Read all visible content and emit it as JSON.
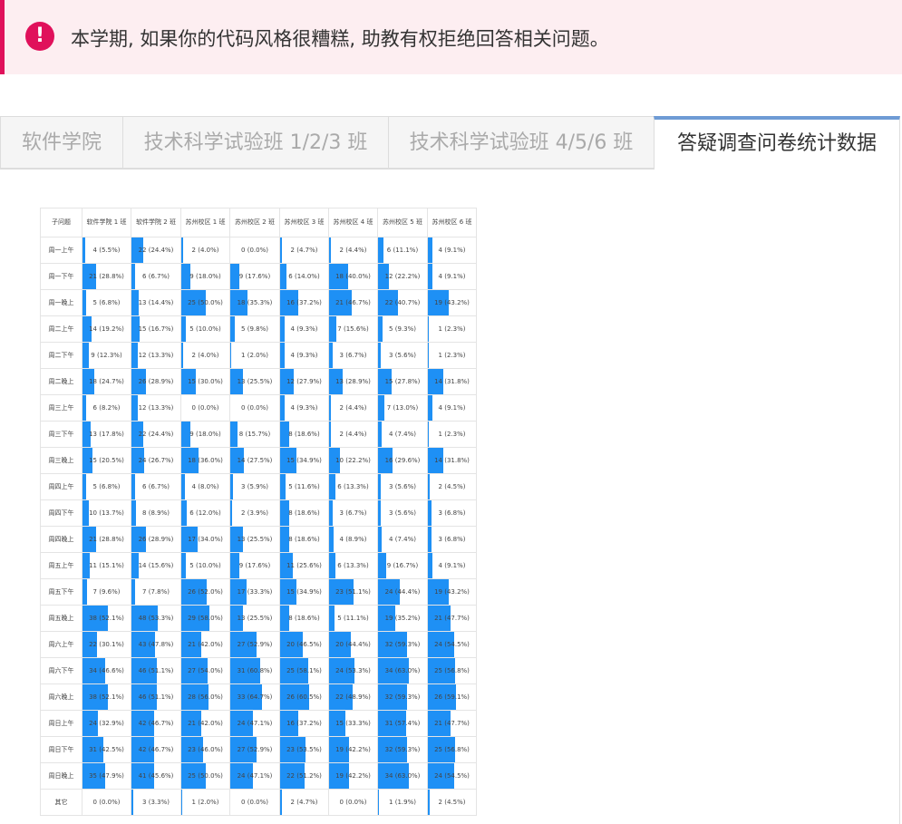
{
  "alert": {
    "icon": "exclamation-icon",
    "icon_glyph": "!",
    "text": "本学期, 如果你的代码风格很糟糕, 助教有权拒绝回答相关问题。"
  },
  "tabs": [
    {
      "label": "软件学院",
      "active": false
    },
    {
      "label": "技术科学试验班 1/2/3 班",
      "active": false
    },
    {
      "label": "技术科学试验班 4/5/6 班",
      "active": false
    },
    {
      "label": "答疑调查问卷统计数据",
      "active": true
    }
  ],
  "colors": {
    "accent": "#e0115b",
    "bar": "#1e90f5",
    "active_tab": "#6e9bd5"
  },
  "table": {
    "corner": "子问题",
    "columns": [
      "软件学院 1 班",
      "软件学院 2 班",
      "苏州校区 1 班",
      "苏州校区 2 班",
      "苏州校区 3 班",
      "苏州校区 4 班",
      "苏州校区 5 班",
      "苏州校区 6 班"
    ],
    "rows": [
      {
        "label": "周一上午",
        "cells": [
          [
            4,
            "5.5%"
          ],
          [
            22,
            "24.4%"
          ],
          [
            2,
            "4.0%"
          ],
          [
            0,
            "0.0%"
          ],
          [
            2,
            "4.7%"
          ],
          [
            2,
            "4.4%"
          ],
          [
            6,
            "11.1%"
          ],
          [
            4,
            "9.1%"
          ]
        ]
      },
      {
        "label": "周一下午",
        "cells": [
          [
            21,
            "28.8%"
          ],
          [
            6,
            "6.7%"
          ],
          [
            9,
            "18.0%"
          ],
          [
            9,
            "17.6%"
          ],
          [
            6,
            "14.0%"
          ],
          [
            18,
            "40.0%"
          ],
          [
            12,
            "22.2%"
          ],
          [
            4,
            "9.1%"
          ]
        ]
      },
      {
        "label": "周一晚上",
        "cells": [
          [
            5,
            "6.8%"
          ],
          [
            13,
            "14.4%"
          ],
          [
            25,
            "50.0%"
          ],
          [
            18,
            "35.3%"
          ],
          [
            16,
            "37.2%"
          ],
          [
            21,
            "46.7%"
          ],
          [
            22,
            "40.7%"
          ],
          [
            19,
            "43.2%"
          ]
        ]
      },
      {
        "label": "周二上午",
        "cells": [
          [
            14,
            "19.2%"
          ],
          [
            15,
            "16.7%"
          ],
          [
            5,
            "10.0%"
          ],
          [
            5,
            "9.8%"
          ],
          [
            4,
            "9.3%"
          ],
          [
            7,
            "15.6%"
          ],
          [
            5,
            "9.3%"
          ],
          [
            1,
            "2.3%"
          ]
        ]
      },
      {
        "label": "周二下午",
        "cells": [
          [
            9,
            "12.3%"
          ],
          [
            12,
            "13.3%"
          ],
          [
            2,
            "4.0%"
          ],
          [
            1,
            "2.0%"
          ],
          [
            4,
            "9.3%"
          ],
          [
            3,
            "6.7%"
          ],
          [
            3,
            "5.6%"
          ],
          [
            1,
            "2.3%"
          ]
        ]
      },
      {
        "label": "周二晚上",
        "cells": [
          [
            18,
            "24.7%"
          ],
          [
            26,
            "28.9%"
          ],
          [
            15,
            "30.0%"
          ],
          [
            13,
            "25.5%"
          ],
          [
            12,
            "27.9%"
          ],
          [
            13,
            "28.9%"
          ],
          [
            15,
            "27.8%"
          ],
          [
            14,
            "31.8%"
          ]
        ]
      },
      {
        "label": "周三上午",
        "cells": [
          [
            6,
            "8.2%"
          ],
          [
            12,
            "13.3%"
          ],
          [
            0,
            "0.0%"
          ],
          [
            0,
            "0.0%"
          ],
          [
            4,
            "9.3%"
          ],
          [
            2,
            "4.4%"
          ],
          [
            7,
            "13.0%"
          ],
          [
            4,
            "9.1%"
          ]
        ]
      },
      {
        "label": "周三下午",
        "cells": [
          [
            13,
            "17.8%"
          ],
          [
            22,
            "24.4%"
          ],
          [
            9,
            "18.0%"
          ],
          [
            8,
            "15.7%"
          ],
          [
            8,
            "18.6%"
          ],
          [
            2,
            "4.4%"
          ],
          [
            4,
            "7.4%"
          ],
          [
            1,
            "2.3%"
          ]
        ]
      },
      {
        "label": "周三晚上",
        "cells": [
          [
            15,
            "20.5%"
          ],
          [
            24,
            "26.7%"
          ],
          [
            18,
            "36.0%"
          ],
          [
            14,
            "27.5%"
          ],
          [
            15,
            "34.9%"
          ],
          [
            10,
            "22.2%"
          ],
          [
            16,
            "29.6%"
          ],
          [
            14,
            "31.8%"
          ]
        ]
      },
      {
        "label": "周四上午",
        "cells": [
          [
            5,
            "6.8%"
          ],
          [
            6,
            "6.7%"
          ],
          [
            4,
            "8.0%"
          ],
          [
            3,
            "5.9%"
          ],
          [
            5,
            "11.6%"
          ],
          [
            6,
            "13.3%"
          ],
          [
            3,
            "5.6%"
          ],
          [
            2,
            "4.5%"
          ]
        ]
      },
      {
        "label": "周四下午",
        "cells": [
          [
            10,
            "13.7%"
          ],
          [
            8,
            "8.9%"
          ],
          [
            6,
            "12.0%"
          ],
          [
            2,
            "3.9%"
          ],
          [
            8,
            "18.6%"
          ],
          [
            3,
            "6.7%"
          ],
          [
            3,
            "5.6%"
          ],
          [
            3,
            "6.8%"
          ]
        ]
      },
      {
        "label": "周四晚上",
        "cells": [
          [
            21,
            "28.8%"
          ],
          [
            26,
            "28.9%"
          ],
          [
            17,
            "34.0%"
          ],
          [
            13,
            "25.5%"
          ],
          [
            8,
            "18.6%"
          ],
          [
            4,
            "8.9%"
          ],
          [
            4,
            "7.4%"
          ],
          [
            3,
            "6.8%"
          ]
        ]
      },
      {
        "label": "周五上午",
        "cells": [
          [
            11,
            "15.1%"
          ],
          [
            14,
            "15.6%"
          ],
          [
            5,
            "10.0%"
          ],
          [
            9,
            "17.6%"
          ],
          [
            11,
            "25.6%"
          ],
          [
            6,
            "13.3%"
          ],
          [
            9,
            "16.7%"
          ],
          [
            4,
            "9.1%"
          ]
        ]
      },
      {
        "label": "周五下午",
        "cells": [
          [
            7,
            "9.6%"
          ],
          [
            7,
            "7.8%"
          ],
          [
            26,
            "52.0%"
          ],
          [
            17,
            "33.3%"
          ],
          [
            15,
            "34.9%"
          ],
          [
            23,
            "51.1%"
          ],
          [
            24,
            "44.4%"
          ],
          [
            19,
            "43.2%"
          ]
        ]
      },
      {
        "label": "周五晚上",
        "cells": [
          [
            38,
            "52.1%"
          ],
          [
            48,
            "53.3%"
          ],
          [
            29,
            "58.0%"
          ],
          [
            13,
            "25.5%"
          ],
          [
            8,
            "18.6%"
          ],
          [
            5,
            "11.1%"
          ],
          [
            19,
            "35.2%"
          ],
          [
            21,
            "47.7%"
          ]
        ]
      },
      {
        "label": "周六上午",
        "cells": [
          [
            22,
            "30.1%"
          ],
          [
            43,
            "47.8%"
          ],
          [
            21,
            "42.0%"
          ],
          [
            27,
            "52.9%"
          ],
          [
            20,
            "46.5%"
          ],
          [
            20,
            "44.4%"
          ],
          [
            32,
            "59.3%"
          ],
          [
            24,
            "54.5%"
          ]
        ]
      },
      {
        "label": "周六下午",
        "cells": [
          [
            34,
            "46.6%"
          ],
          [
            46,
            "51.1%"
          ],
          [
            27,
            "54.0%"
          ],
          [
            31,
            "60.8%"
          ],
          [
            25,
            "58.1%"
          ],
          [
            24,
            "53.3%"
          ],
          [
            34,
            "63.0%"
          ],
          [
            25,
            "56.8%"
          ]
        ]
      },
      {
        "label": "周六晚上",
        "cells": [
          [
            38,
            "52.1%"
          ],
          [
            46,
            "51.1%"
          ],
          [
            28,
            "56.0%"
          ],
          [
            33,
            "64.7%"
          ],
          [
            26,
            "60.5%"
          ],
          [
            22,
            "48.9%"
          ],
          [
            32,
            "59.3%"
          ],
          [
            26,
            "59.1%"
          ]
        ]
      },
      {
        "label": "周日上午",
        "cells": [
          [
            24,
            "32.9%"
          ],
          [
            42,
            "46.7%"
          ],
          [
            21,
            "42.0%"
          ],
          [
            24,
            "47.1%"
          ],
          [
            16,
            "37.2%"
          ],
          [
            15,
            "33.3%"
          ],
          [
            31,
            "57.4%"
          ],
          [
            21,
            "47.7%"
          ]
        ]
      },
      {
        "label": "周日下午",
        "cells": [
          [
            31,
            "42.5%"
          ],
          [
            42,
            "46.7%"
          ],
          [
            23,
            "46.0%"
          ],
          [
            27,
            "52.9%"
          ],
          [
            23,
            "53.5%"
          ],
          [
            19,
            "42.2%"
          ],
          [
            32,
            "59.3%"
          ],
          [
            25,
            "56.8%"
          ]
        ]
      },
      {
        "label": "周日晚上",
        "cells": [
          [
            35,
            "47.9%"
          ],
          [
            41,
            "45.6%"
          ],
          [
            25,
            "50.0%"
          ],
          [
            24,
            "47.1%"
          ],
          [
            22,
            "51.2%"
          ],
          [
            19,
            "42.2%"
          ],
          [
            34,
            "63.0%"
          ],
          [
            24,
            "54.5%"
          ]
        ]
      },
      {
        "label": "其它",
        "cells": [
          [
            0,
            "0.0%"
          ],
          [
            3,
            "3.3%"
          ],
          [
            1,
            "2.0%"
          ],
          [
            0,
            "0.0%"
          ],
          [
            2,
            "4.7%"
          ],
          [
            0,
            "0.0%"
          ],
          [
            1,
            "1.9%"
          ],
          [
            2,
            "4.5%"
          ]
        ]
      }
    ]
  }
}
